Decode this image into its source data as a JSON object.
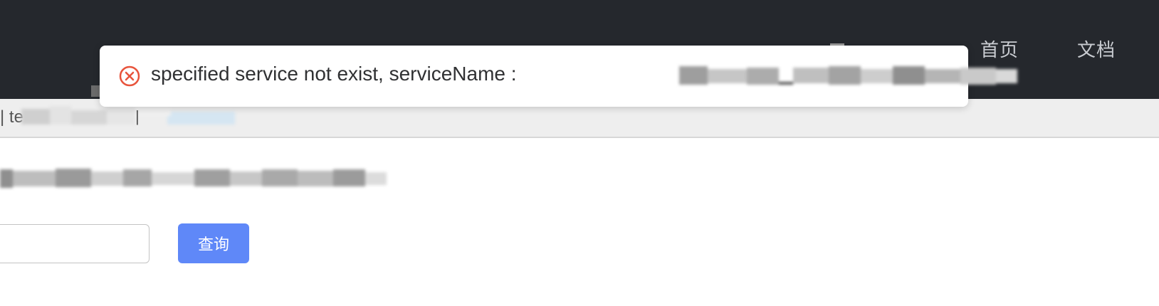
{
  "nav": {
    "items": [
      {
        "label": "首页"
      },
      {
        "label": "文档"
      }
    ]
  },
  "breadcrumb": {
    "prefix": "| te",
    "separator": "|"
  },
  "main": {
    "query_button_label": "查询",
    "search_input_value": ""
  },
  "toast": {
    "type": "error",
    "icon": "error-circle-icon",
    "message": "specified service not exist, serviceName :",
    "color": "#e8543c"
  },
  "colors": {
    "topbar": "#25282d",
    "primary": "#5f88f8",
    "error": "#e8543c"
  }
}
